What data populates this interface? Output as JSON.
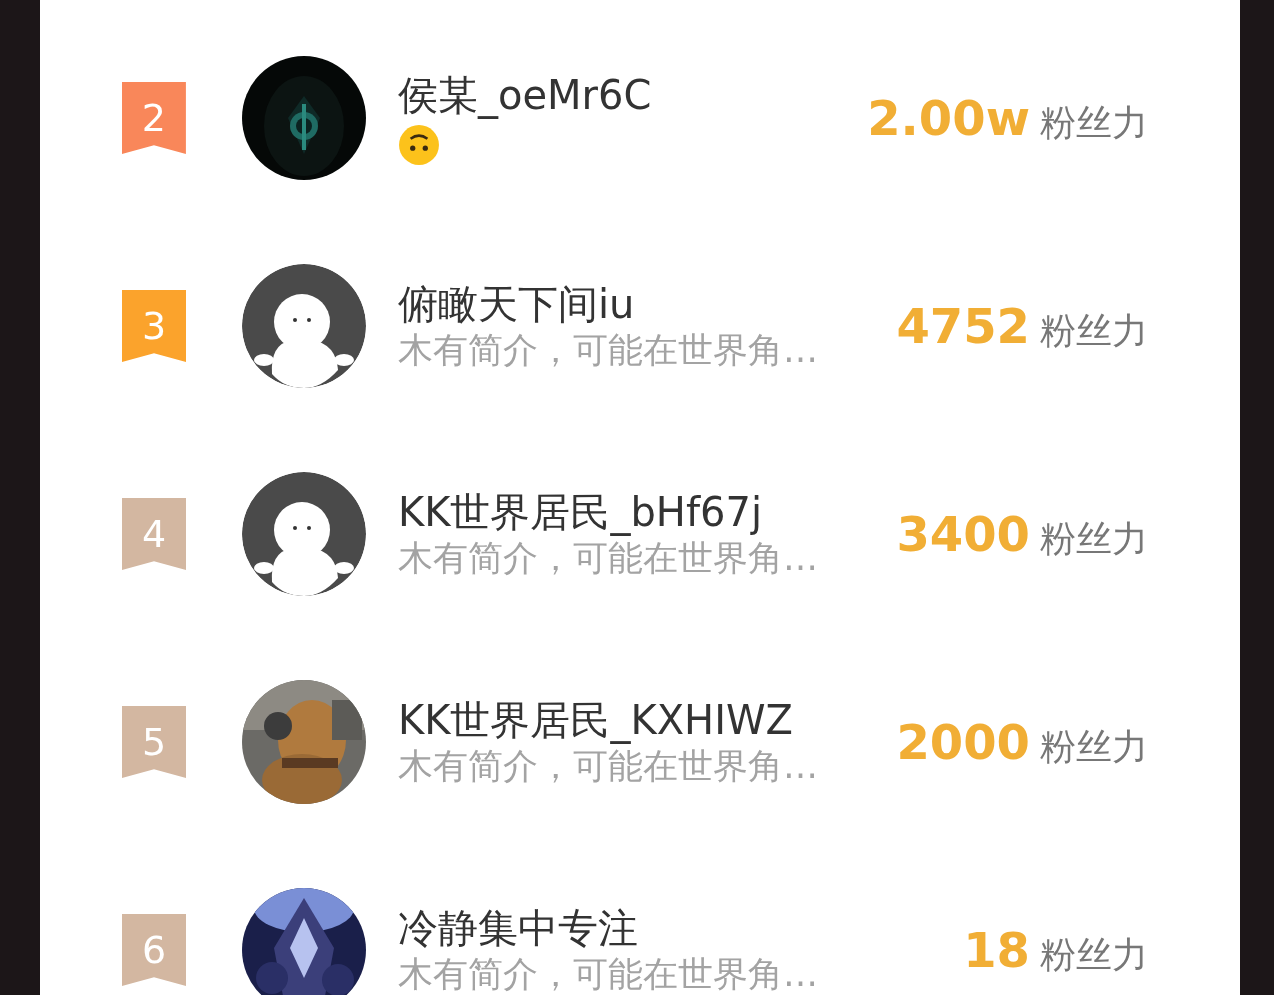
{
  "ranking": [
    {
      "rank": "2",
      "color": "#f9875a",
      "name": "侯某_oeMr6C",
      "bio": {
        "kind": "emoji"
      },
      "score": "2.00w",
      "score_unit": "粉丝力"
    },
    {
      "rank": "3",
      "color": "#fba32c",
      "avatar": {
        "kind": "default"
      },
      "name": "俯瞰天下间iu",
      "bio": {
        "kind": "text",
        "text": "木有简介，可能在世界角…"
      },
      "score": "4752",
      "score_unit": "粉丝力"
    },
    {
      "rank": "4",
      "color": "#d3b7a1",
      "avatar": {
        "kind": "default"
      },
      "name": "KK世界居民_bHf67j",
      "bio": {
        "kind": "text",
        "text": "木有简介，可能在世界角…"
      },
      "score": "3400",
      "score_unit": "粉丝力"
    },
    {
      "rank": "5",
      "color": "#d3b7a1",
      "name": "KK世界居民_KXHIWZ",
      "bio": {
        "kind": "text",
        "text": "木有简介，可能在世界角…"
      },
      "score": "2000",
      "score_unit": "粉丝力"
    },
    {
      "rank": "6",
      "color": "#d3b7a1",
      "name": "冷静集中专注",
      "bio": {
        "kind": "text",
        "text": "木有简介，可能在世界角…"
      },
      "score": "18",
      "score_unit": "粉丝力"
    }
  ]
}
